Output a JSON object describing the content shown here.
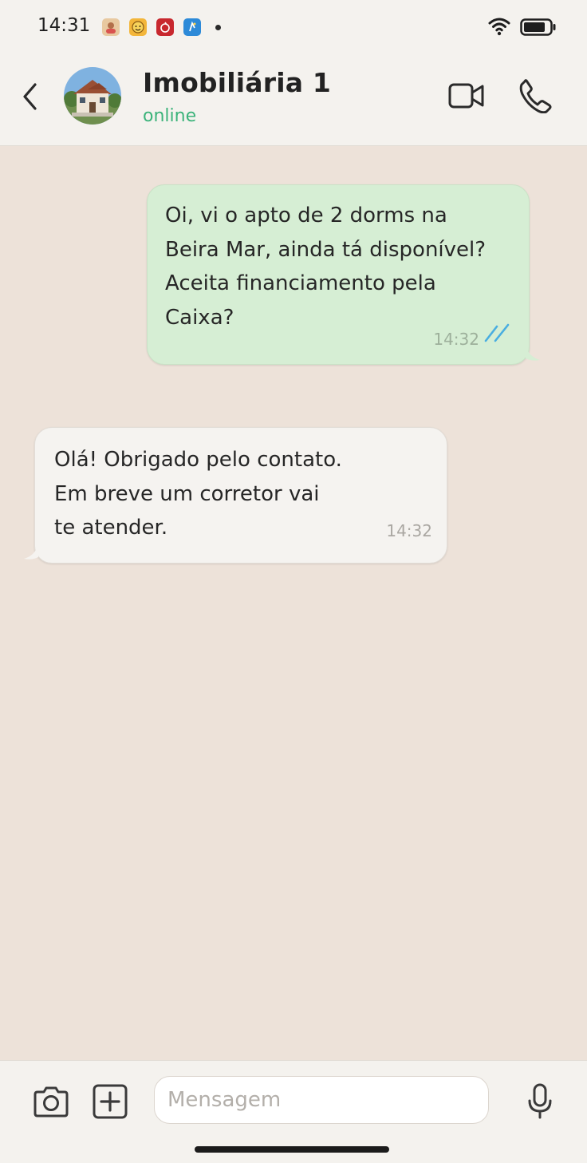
{
  "status_bar": {
    "time": "14:31",
    "notification_icons": [
      "photo-app-icon",
      "emoji-app-icon",
      "red-app-icon",
      "blue-app-icon"
    ],
    "wifi_icon": "wifi-icon",
    "battery_icon": "battery-icon"
  },
  "header": {
    "contact_name": "Imobiliária 1",
    "status": "online",
    "avatar_icon": "house-avatar-icon",
    "back_icon": "chevron-left-icon",
    "video_icon": "video-camera-icon",
    "call_icon": "phone-icon"
  },
  "messages": [
    {
      "direction": "outgoing",
      "text": "Oi, vi o apto de 2 dorms na\nBeira Mar, ainda tá disponível?\nAceita financiamento pela\nCaixa?",
      "time": "14:32",
      "status_icon": "double-check-read-icon"
    },
    {
      "direction": "incoming",
      "text": "Olá! Obrigado pelo contato.\nEm breve um corretor vai\nte atender.",
      "time": "14:32"
    }
  ],
  "composer": {
    "placeholder": "Mensagem",
    "value": "",
    "camera_icon": "camera-icon",
    "add_icon": "plus-square-icon",
    "mic_icon": "microphone-icon"
  },
  "colors": {
    "chat_background": "#ede2d9",
    "outgoing_bubble": "#d6eed4",
    "incoming_bubble": "#f5f3f0",
    "online_status": "#3bb37a",
    "read_ticks": "#4aaee0"
  }
}
